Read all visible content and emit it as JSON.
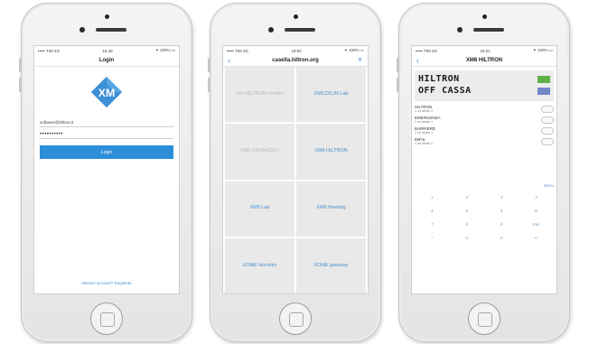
{
  "phones": [
    {
      "status": {
        "left": "••••• TIM  4G",
        "time": "18:48",
        "right": "✦ 100% ▭"
      },
      "title": "Login",
      "email": "software@hiltron.it",
      "password": "••••••••••",
      "login_label": "Login",
      "footer_link": "Nessun account? Registrati"
    },
    {
      "status": {
        "left": "••••• TIM  4G",
        "time": "18:50",
        "right": "✦ 100% ▭"
      },
      "back": "‹",
      "title": "casella.hiltron.org",
      "add": "+",
      "tiles": [
        {
          "label": "XM HILTRON remoto",
          "dim": true
        },
        {
          "label": "XMCOS.IN Lab",
          "dim": false
        },
        {
          "label": "XM8 CASAROSY",
          "dim": true
        },
        {
          "label": "XM8 HILTRON",
          "dim": false
        },
        {
          "label": "XM8 Lab",
          "dim": false
        },
        {
          "label": "XM8 Meeting",
          "dim": false
        },
        {
          "label": "XOME Hiroshio",
          "dim": false
        },
        {
          "label": "XOME gateway",
          "dim": false
        }
      ]
    },
    {
      "status": {
        "left": "••••• TIM  4G",
        "time": "18:51",
        "right": "✦ 100% ▭"
      },
      "back": "‹",
      "title": "XM8 HILTRON",
      "lcd": {
        "line1": "HILTRON",
        "line2": "OFF CASSA",
        "led1_color": "#5fb24a",
        "led2_color": "#7387c8"
      },
      "menu": [
        {
          "name": "HILTRON",
          "sub": "1 on Mode 1"
        },
        {
          "name": "EMERGENZA",
          "sub": "2 on Mode 1"
        },
        {
          "name": "BARRIERE",
          "sub": "3 on Mode 1"
        },
        {
          "name": "IMP.6",
          "sub": "4 on Mode 1"
        }
      ],
      "menu_button": "Menu",
      "keys": [
        "1",
        "2",
        "3",
        "A",
        "4",
        "5",
        "6",
        "B",
        "7",
        "8",
        "9",
        "Esc",
        "*",
        "0",
        "#",
        "↵"
      ]
    }
  ],
  "colors": {
    "accent": "#2d8fda",
    "logo": "#3d8fd6"
  }
}
